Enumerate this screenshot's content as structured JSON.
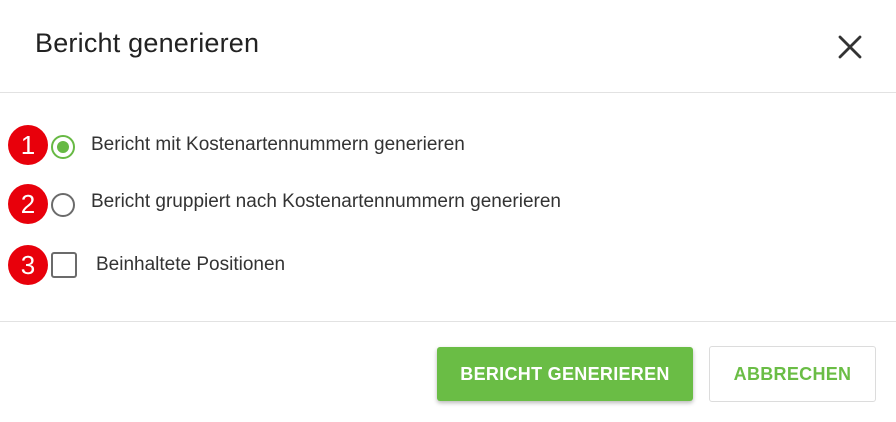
{
  "dialog": {
    "title": "Bericht generieren"
  },
  "options": [
    {
      "badge": "1",
      "label": "Bericht mit Kostenartennummern generieren",
      "type": "radio",
      "checked": true
    },
    {
      "badge": "2",
      "label": "Bericht gruppiert nach Kostenartennummern generieren",
      "type": "radio",
      "checked": false
    },
    {
      "badge": "3",
      "label": "Beinhaltete Positionen",
      "type": "checkbox",
      "checked": false
    }
  ],
  "footer": {
    "primary_label": "BERICHT GENERIEREN",
    "secondary_label": "ABBRECHEN"
  },
  "colors": {
    "accent": "#6abd45",
    "badge": "#e8000b"
  },
  "icons": {
    "close": "close-icon"
  }
}
